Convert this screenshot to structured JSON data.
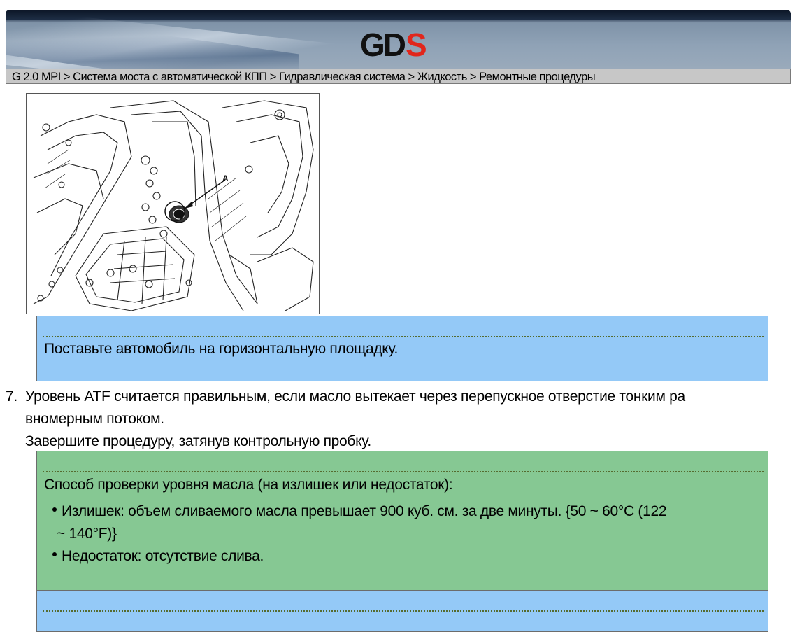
{
  "header": {
    "logo": {
      "main": "GD",
      "accent": "S",
      "accent_color": "#e1261c"
    },
    "breadcrumb": "G 2.0 MPI > Система моста с автоматической КПП > Гидравлическая система > Жидкость > Ремонтные процедуры"
  },
  "figure": {
    "callout_label": "A"
  },
  "note1": {
    "text": "Поставьте автомобиль на горизонтальную площадку."
  },
  "step7": {
    "number": "7.",
    "line1": "Уровень ATF  считается правильным, если масло вытекает через перепускное отверстие тонким ра",
    "line2": "вномерным потоком.",
    "line3": "Завершите процедуру, затянув контрольную пробку."
  },
  "note2": {
    "title": "Способ проверки уровня масла (на излишек или недостаток):",
    "bullet1_line1": "Излишек: объем сливаемого масла превышает 900 куб. см. за две минуты. {50 ~ 60°C (122",
    "bullet1_line2": "~ 140°F)}",
    "bullet2": "Недостаток: отсутствие слива."
  },
  "note3": {
    "text": ""
  },
  "colors": {
    "note_blue": "#94c9f7",
    "note_green": "#86c893",
    "breadcrumb_bg": "#c7c7c7"
  }
}
